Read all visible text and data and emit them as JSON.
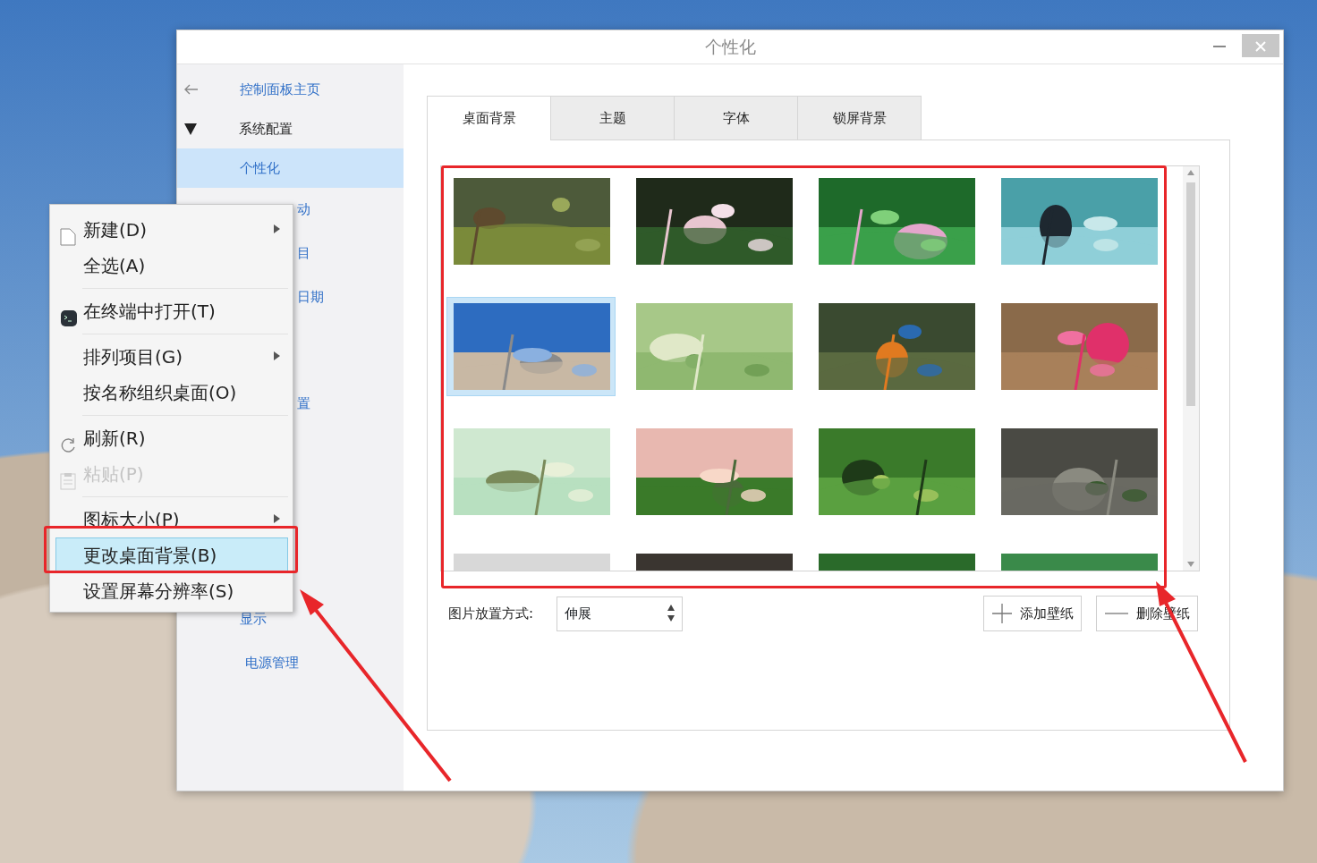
{
  "window": {
    "title": "个性化"
  },
  "sidebar": {
    "home_link": "控制面板主页",
    "section": {
      "label": "系统配置",
      "expanded": true,
      "children": [
        {
          "label": "个性化",
          "selected": true,
          "kind": "item"
        },
        {
          "label": "动",
          "selected": false,
          "kind": "fragment"
        },
        {
          "label": "目",
          "selected": false,
          "kind": "fragment"
        },
        {
          "label": "日期",
          "selected": false,
          "kind": "fragment"
        },
        {
          "label": "置",
          "selected": false,
          "kind": "fragment"
        },
        {
          "label": "显示",
          "selected": false,
          "kind": "item"
        },
        {
          "label": "电源管理",
          "selected": false,
          "kind": "item"
        }
      ]
    }
  },
  "tabs": [
    {
      "label": "桌面背景",
      "selected": true
    },
    {
      "label": "主题",
      "selected": false
    },
    {
      "label": "字体",
      "selected": false
    },
    {
      "label": "锁屏背景",
      "selected": false
    }
  ],
  "wallpapers": [
    {
      "selected": false
    },
    {
      "selected": false
    },
    {
      "selected": false
    },
    {
      "selected": false
    },
    {
      "selected": true
    },
    {
      "selected": false
    },
    {
      "selected": false
    },
    {
      "selected": false
    },
    {
      "selected": false
    },
    {
      "selected": false
    },
    {
      "selected": false
    },
    {
      "selected": false
    },
    {
      "selected": false
    },
    {
      "selected": false
    },
    {
      "selected": false
    },
    {
      "selected": false
    }
  ],
  "placement": {
    "label": "图片放置方式:",
    "value": "伸展"
  },
  "buttons": [
    {
      "label": "添加壁纸",
      "kind": "add"
    },
    {
      "label": "删除壁纸",
      "kind": "remove"
    }
  ],
  "context_menu": {
    "groups": [
      [
        {
          "label": "新建(D)",
          "kind": "new",
          "submenu": true,
          "disabled": false,
          "selected": false
        },
        {
          "label": "全选(A)",
          "kind": "plain",
          "submenu": false,
          "disabled": false,
          "selected": false
        }
      ],
      [
        {
          "label": "在终端中打开(T)",
          "kind": "terminal",
          "submenu": false,
          "disabled": false,
          "selected": false
        }
      ],
      [
        {
          "label": "排列项目(G)",
          "kind": "plain",
          "submenu": true,
          "disabled": false,
          "selected": false
        },
        {
          "label": "按名称组织桌面(O)",
          "kind": "plain",
          "submenu": false,
          "disabled": false,
          "selected": false
        }
      ],
      [
        {
          "label": "刷新(R)",
          "kind": "refresh",
          "submenu": false,
          "disabled": false,
          "selected": false
        },
        {
          "label": "粘贴(P)",
          "kind": "paste",
          "submenu": false,
          "disabled": true,
          "selected": false
        }
      ],
      [
        {
          "label": "图标大小(P)",
          "kind": "plain",
          "submenu": true,
          "disabled": false,
          "selected": false
        },
        {
          "label": "更改桌面背景(B)",
          "kind": "plain",
          "submenu": false,
          "disabled": false,
          "selected": true
        },
        {
          "label": "设置屏幕分辨率(S)",
          "kind": "plain",
          "submenu": false,
          "disabled": false,
          "selected": false
        }
      ]
    ]
  }
}
